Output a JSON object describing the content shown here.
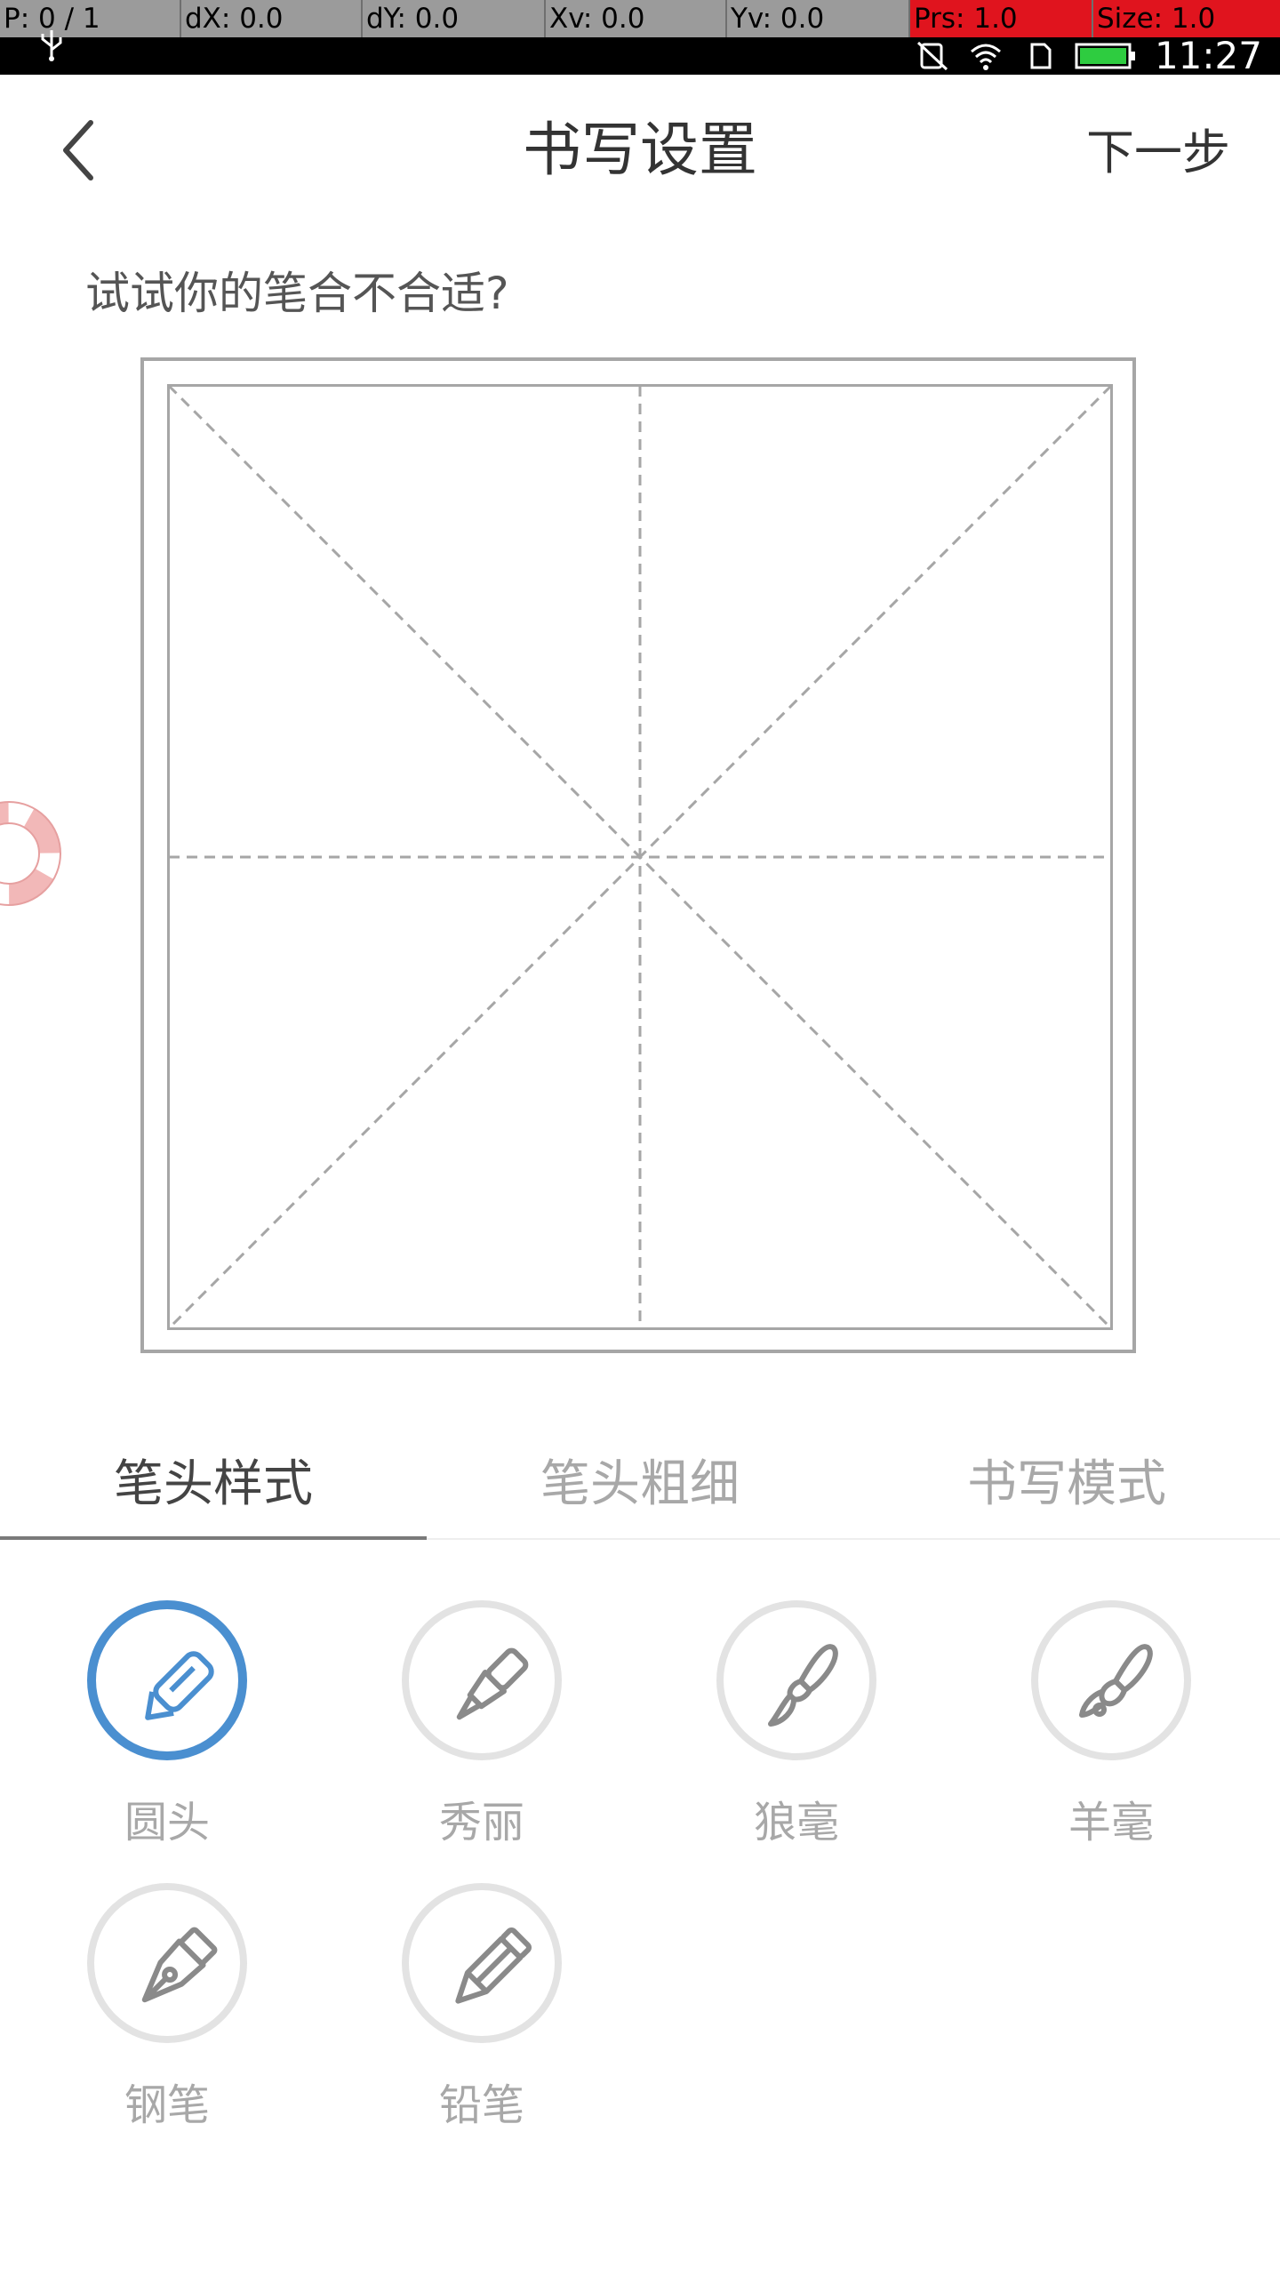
{
  "status_bar": {
    "debug": {
      "pointer": "P: 0 / 1",
      "dx": "dX: 0.0",
      "dy": "dY: 0.0",
      "xv": "Xv: 0.0",
      "yv": "Yv: 0.0",
      "prs": "Prs: 1.0",
      "size": "Size: 1.0"
    },
    "clock": "11:27",
    "icons": [
      "usb-icon",
      "mute-icon",
      "wifi-icon",
      "sim-icon",
      "battery-icon"
    ],
    "battery_color": "#2ecc40"
  },
  "header": {
    "title": "书写设置",
    "next_label": "下一步",
    "back_icon": "chevron-left-icon"
  },
  "prompt": "试试你的笔合不合适?",
  "grid": {
    "type": "mi-zi-ge",
    "border_color": "#a6a6a6",
    "guide_color": "#a6a6a6"
  },
  "tabs": [
    {
      "label": "笔头样式",
      "active": true
    },
    {
      "label": "笔头粗细",
      "active": false
    },
    {
      "label": "书写模式",
      "active": false
    }
  ],
  "pen_options": [
    {
      "label": "圆头",
      "icon": "rounded-pen-icon",
      "selected": true
    },
    {
      "label": "秀丽",
      "icon": "fine-pen-icon",
      "selected": false
    },
    {
      "label": "狼毫",
      "icon": "wolf-brush-icon",
      "selected": false
    },
    {
      "label": "羊毫",
      "icon": "goat-brush-icon",
      "selected": false
    },
    {
      "label": "钢笔",
      "icon": "fountain-pen-icon",
      "selected": false
    },
    {
      "label": "铅笔",
      "icon": "pencil-icon",
      "selected": false
    }
  ],
  "colors": {
    "accent": "#4a8fd0",
    "inactive_ring": "#e3e3e3",
    "inactive_text": "#a8a8a8"
  }
}
